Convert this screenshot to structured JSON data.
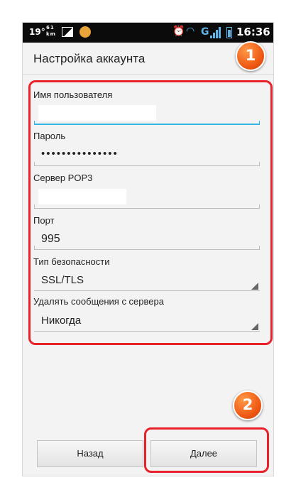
{
  "status_bar": {
    "temperature": "19°",
    "notification_count": "61",
    "notification_unit": "km",
    "network_type": "G",
    "time": "16:36"
  },
  "header": {
    "title": "Настройка аккаунта"
  },
  "form": {
    "username_label": "Имя пользователя",
    "username_value": "",
    "password_label": "Пароль",
    "password_value": "•••••••••••••••",
    "server_label": "Сервер POP3",
    "server_value": "",
    "port_label": "Порт",
    "port_value": "995",
    "security_label": "Тип безопасности",
    "security_value": "SSL/TLS",
    "delete_label": "Удалять сообщения с сервера",
    "delete_value": "Никогда"
  },
  "buttons": {
    "back_label": "Назад",
    "next_label": "Далее"
  },
  "annotations": {
    "badge_1": "1",
    "badge_2": "2",
    "color": "#e8212b",
    "badge_color": "#f05a14"
  },
  "colors": {
    "accent": "#33b5e5",
    "status_icons": "#5fb5e8"
  },
  "icons": [
    "gallery-icon",
    "app-icon",
    "alarm-icon",
    "wifi-icon",
    "signal-icon",
    "battery-icon"
  ]
}
